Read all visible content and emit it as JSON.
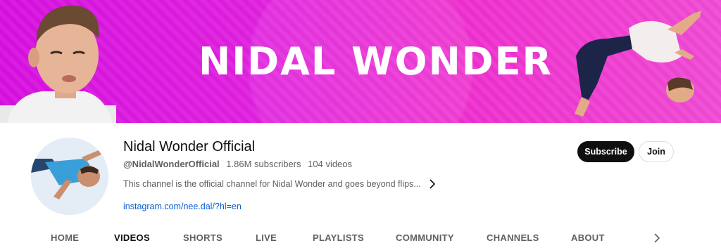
{
  "banner": {
    "title": "NIDAL WONDER"
  },
  "channel": {
    "name": "Nidal Wonder Official",
    "handle": "@NidalWonderOfficial",
    "subscribers": "1.86M subscribers",
    "videos": "104 videos",
    "description": "This channel is the official channel for Nidal Wonder and goes beyond flips...",
    "link": "instagram.com/nee.dal/?hl=en"
  },
  "actions": {
    "subscribe_label": "Subscribe",
    "join_label": "Join"
  },
  "tabs": [
    {
      "label": "HOME"
    },
    {
      "label": "VIDEOS",
      "active": true
    },
    {
      "label": "SHORTS"
    },
    {
      "label": "LIVE"
    },
    {
      "label": "PLAYLISTS"
    },
    {
      "label": "COMMUNITY"
    },
    {
      "label": "CHANNELS"
    },
    {
      "label": "ABOUT"
    }
  ],
  "icons": {
    "description_expand": "chevron-right-icon",
    "tabs_scroll": "chevron-right-icon"
  },
  "colors": {
    "banner": "#e020df",
    "subscribe_bg": "#0f0f0f",
    "link": "#065fd4"
  }
}
